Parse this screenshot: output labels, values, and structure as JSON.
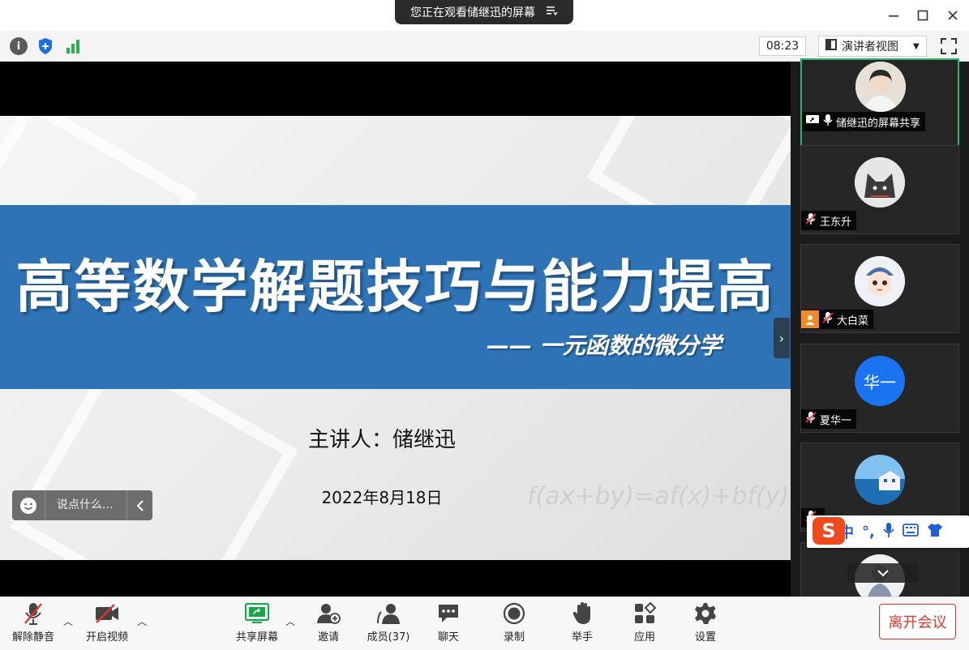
{
  "titlebar": {
    "share_notice": "您正在观看储继迅的屏幕",
    "menu_icon": "list-icon",
    "minimize_icon": "minimize-icon",
    "maximize_icon": "maximize-icon",
    "close_icon": "close-icon"
  },
  "toolbar": {
    "info_icon": "info-icon",
    "security_icon": "shield-icon",
    "signal_icon": "signal-bars-icon",
    "timer": "08:23",
    "view_mode": "演讲者视图",
    "fullscreen_icon": "fullscreen-icon"
  },
  "slide": {
    "title": "高等数学解题技巧与能力提高",
    "subtitle": "—— 一元函数的微分学",
    "presenter": "主讲人：储继迅",
    "date": "2022年8月18日",
    "formula": "f(ax+by)=af(x)+bf(y)"
  },
  "chat": {
    "placeholder": "说点什么..."
  },
  "participants": [
    {
      "name": "储继迅的屏幕共享",
      "muted": false,
      "sharing": true,
      "avatar_color": "#dcd6cf"
    },
    {
      "name": "王东升",
      "muted": true,
      "avatar_color": "#e4e2e3"
    },
    {
      "name": "大白菜",
      "muted": true,
      "host": true,
      "avatar_color": "#eef1f7"
    },
    {
      "name": "夏华一",
      "muted": true,
      "avatar_text": "华一",
      "avatar_color": "#1a73f0"
    },
    {
      "name": "",
      "muted": true,
      "avatar_color": "#3a8ed4"
    },
    {
      "name": "",
      "muted": true,
      "avatar_color": "#dfe6ee"
    }
  ],
  "ime": {
    "logo": "S",
    "mode": "中",
    "punct": "°,",
    "mic_icon": "microphone-icon",
    "keyboard_icon": "keyboard-icon",
    "skin_icon": "shirt-icon"
  },
  "bottombar": {
    "unmute": "解除静音",
    "start_video": "开启视频",
    "share_screen": "共享屏幕",
    "invite": "邀请",
    "members": "成员(37)",
    "chat": "聊天",
    "record": "录制",
    "raise_hand": "举手",
    "apps": "应用",
    "settings": "设置",
    "leave": "离开会议"
  },
  "colors": {
    "banner": "#2f73b7",
    "active_border": "#2fb56b",
    "leave_red": "#e0352b",
    "share_green": "#1aa74a"
  }
}
